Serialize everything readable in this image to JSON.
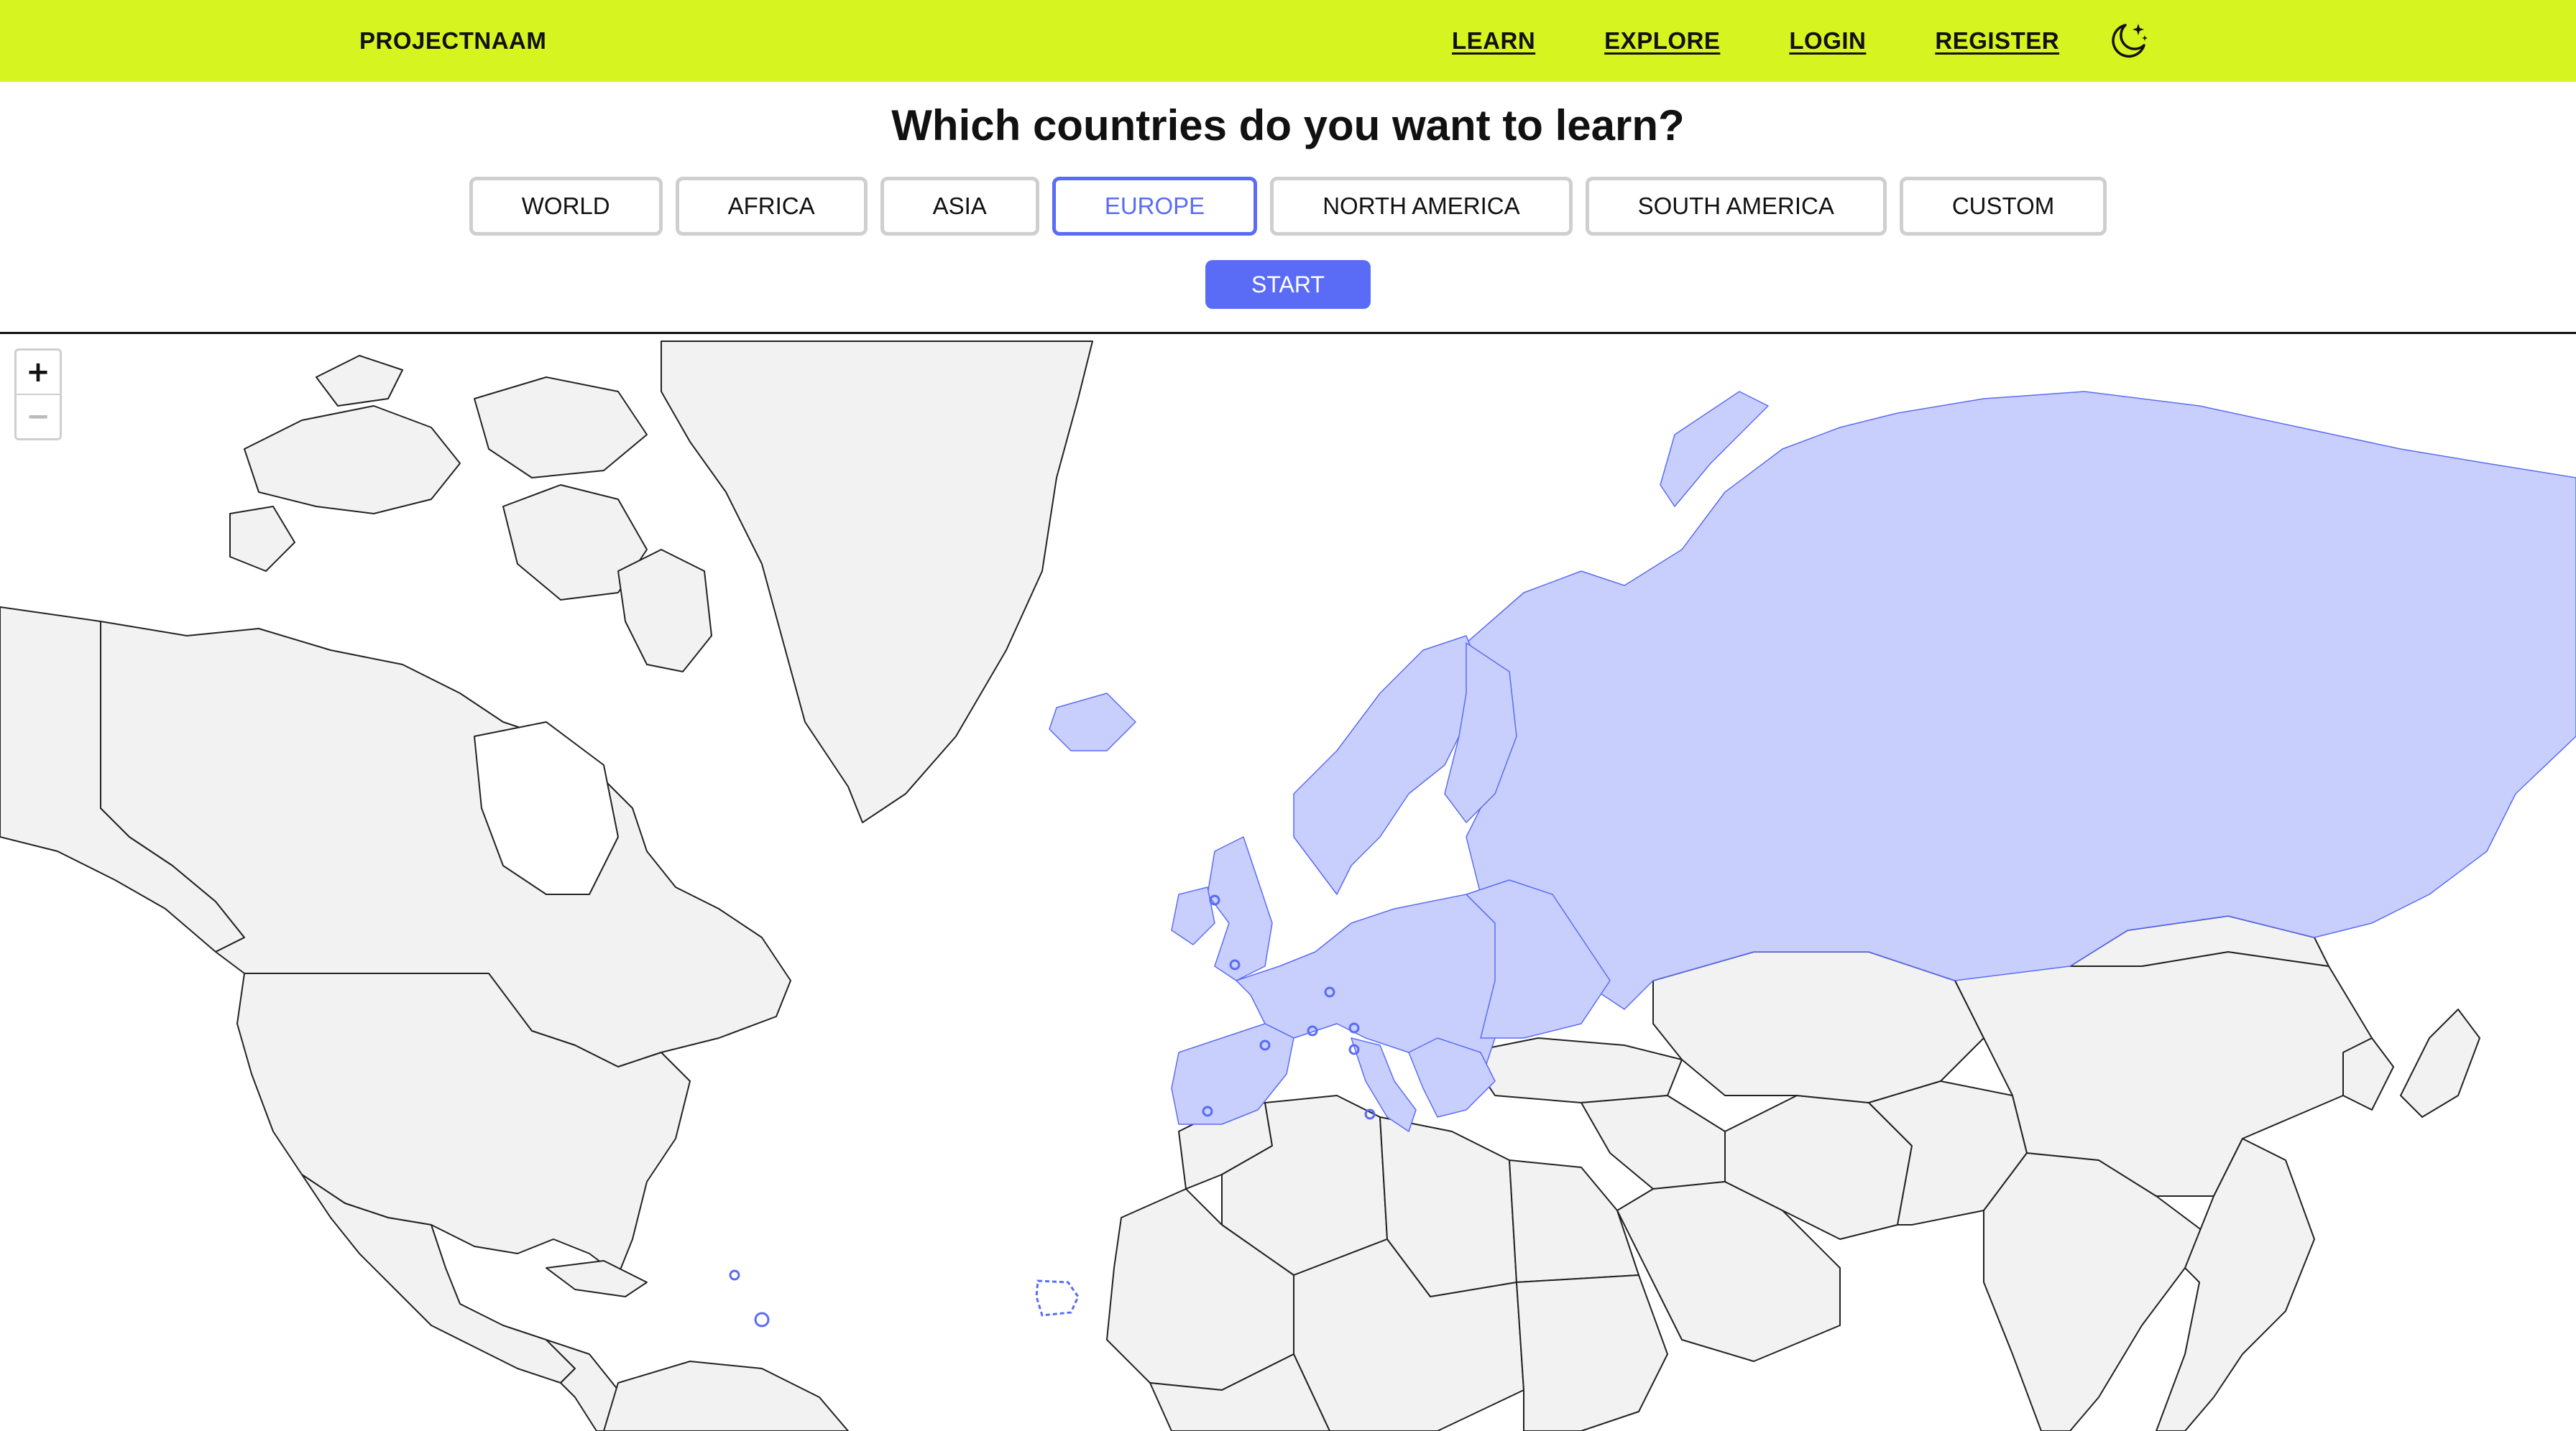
{
  "header": {
    "brand": "PROJECTNAAM",
    "nav": [
      {
        "label": "LEARN"
      },
      {
        "label": "EXPLORE"
      },
      {
        "label": "LOGIN"
      },
      {
        "label": "REGISTER"
      }
    ],
    "theme_icon": "moon-stars-icon"
  },
  "main": {
    "title": "Which countries do you want to learn?",
    "regions": [
      {
        "label": "WORLD",
        "selected": false
      },
      {
        "label": "AFRICA",
        "selected": false
      },
      {
        "label": "ASIA",
        "selected": false
      },
      {
        "label": "EUROPE",
        "selected": true
      },
      {
        "label": "NORTH AMERICA",
        "selected": false
      },
      {
        "label": "SOUTH AMERICA",
        "selected": false
      },
      {
        "label": "CUSTOM",
        "selected": false
      }
    ],
    "start_label": "START"
  },
  "map": {
    "zoom_in_label": "+",
    "zoom_out_label": "−",
    "selected_region": "Europe",
    "colors": {
      "land": "#f2f2f2",
      "border": "#222222",
      "highlight": "#c9cffd",
      "highlight_border": "#5a6cf5",
      "accent": "#5a6cf5",
      "header_bg": "#d6f41f"
    }
  }
}
